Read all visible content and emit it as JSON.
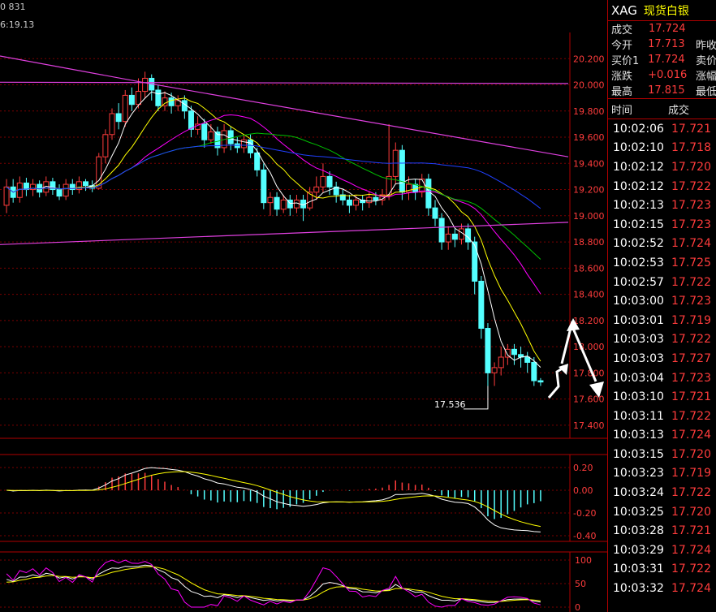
{
  "header": {
    "code_partial": "0 831",
    "time_partial": "6:19.13"
  },
  "axis": {
    "main": [
      "20.200",
      "20.000",
      "19.800",
      "19.600",
      "19.400",
      "19.200",
      "19.000",
      "18.800",
      "18.600",
      "18.400",
      "18.200",
      "18.000",
      "17.800",
      "17.600",
      "17.400"
    ],
    "macd": [
      "0.20",
      "0.00",
      "-0.20",
      "-0.40"
    ],
    "kdj": [
      "100",
      "50",
      "0"
    ]
  },
  "low_annotation": "17.536",
  "colors": {
    "up": "#ff3c3c",
    "down": "#54ffff",
    "grid": "#7a0000",
    "ma5": "#ffffff",
    "ma10": "#ffff00",
    "ma20": "#ff00ff",
    "ma30": "#00c000",
    "ma60": "#2040ff",
    "trend": "#e040e0"
  },
  "quote": {
    "code": "XAG",
    "name": "现货白银",
    "rows": [
      {
        "label": "成交",
        "value": "17.724",
        "label2": ""
      },
      {
        "label": "今开",
        "value": "17.713",
        "label2": "昨收"
      },
      {
        "label": "买价1",
        "value": "17.724",
        "label2": "卖价"
      },
      {
        "label": "涨跌",
        "value": "+0.016",
        "label2": "涨幅"
      },
      {
        "label": "最高",
        "value": "17.815",
        "label2": "最低"
      }
    ]
  },
  "ticks": {
    "header": {
      "time": "时间",
      "price": "成交"
    },
    "rows": [
      {
        "time": "10:02:06",
        "price": "17.721"
      },
      {
        "time": "10:02:10",
        "price": "17.718"
      },
      {
        "time": "10:02:12",
        "price": "17.720"
      },
      {
        "time": "10:02:12",
        "price": "17.722"
      },
      {
        "time": "10:02:13",
        "price": "17.723"
      },
      {
        "time": "10:02:15",
        "price": "17.723"
      },
      {
        "time": "10:02:52",
        "price": "17.724"
      },
      {
        "time": "10:02:53",
        "price": "17.725"
      },
      {
        "time": "10:02:57",
        "price": "17.722"
      },
      {
        "time": "10:03:00",
        "price": "17.723"
      },
      {
        "time": "10:03:01",
        "price": "17.719"
      },
      {
        "time": "10:03:03",
        "price": "17.722"
      },
      {
        "time": "10:03:03",
        "price": "17.727"
      },
      {
        "time": "10:03:04",
        "price": "17.723"
      },
      {
        "time": "10:03:10",
        "price": "17.721"
      },
      {
        "time": "10:03:11",
        "price": "17.722"
      },
      {
        "time": "10:03:13",
        "price": "17.724"
      },
      {
        "time": "10:03:15",
        "price": "17.720"
      },
      {
        "time": "10:03:23",
        "price": "17.719"
      },
      {
        "time": "10:03:24",
        "price": "17.722"
      },
      {
        "time": "10:03:25",
        "price": "17.720"
      },
      {
        "time": "10:03:28",
        "price": "17.721"
      },
      {
        "time": "10:03:29",
        "price": "17.724"
      },
      {
        "time": "10:03:31",
        "price": "17.722"
      },
      {
        "time": "10:03:32",
        "price": "17.724"
      }
    ]
  },
  "chart_data": {
    "type": "candlestick",
    "ylim": [
      17.3,
      20.4
    ],
    "candles": [
      [
        19.08,
        19.22,
        19.02,
        19.28
      ],
      [
        19.22,
        19.14,
        19.1,
        19.28
      ],
      [
        19.14,
        19.25,
        19.1,
        19.3
      ],
      [
        19.25,
        19.2,
        19.15,
        19.29
      ],
      [
        19.2,
        19.24,
        19.15,
        19.28
      ],
      [
        19.24,
        19.18,
        19.14,
        19.27
      ],
      [
        19.18,
        19.26,
        19.15,
        19.3
      ],
      [
        19.26,
        19.2,
        19.16,
        19.29
      ],
      [
        19.2,
        19.15,
        19.12,
        19.24
      ],
      [
        19.15,
        19.24,
        19.12,
        19.28
      ],
      [
        19.24,
        19.2,
        19.16,
        19.28
      ],
      [
        19.2,
        19.26,
        19.17,
        19.3
      ],
      [
        19.26,
        19.23,
        19.19,
        19.28
      ],
      [
        19.23,
        19.21,
        19.18,
        19.27
      ],
      [
        19.21,
        19.45,
        19.2,
        19.48
      ],
      [
        19.45,
        19.62,
        19.4,
        19.66
      ],
      [
        19.62,
        19.78,
        19.58,
        19.82
      ],
      [
        19.78,
        19.72,
        19.66,
        19.86
      ],
      [
        19.72,
        19.92,
        19.68,
        19.96
      ],
      [
        19.92,
        19.85,
        19.8,
        19.98
      ],
      [
        19.85,
        19.95,
        19.82,
        20.05
      ],
      [
        19.95,
        20.05,
        19.9,
        20.1
      ],
      [
        20.05,
        19.96,
        19.88,
        20.08
      ],
      [
        19.96,
        19.84,
        19.8,
        20.0
      ],
      [
        19.84,
        19.9,
        19.8,
        19.95
      ],
      [
        19.9,
        19.84,
        19.78,
        19.94
      ],
      [
        19.84,
        19.88,
        19.8,
        19.92
      ],
      [
        19.88,
        19.8,
        19.74,
        19.92
      ],
      [
        19.8,
        19.66,
        19.6,
        19.84
      ],
      [
        19.66,
        19.7,
        19.62,
        19.76
      ],
      [
        19.7,
        19.58,
        19.52,
        19.74
      ],
      [
        19.58,
        19.64,
        19.55,
        19.7
      ],
      [
        19.64,
        19.52,
        19.46,
        19.68
      ],
      [
        19.52,
        19.65,
        19.48,
        19.7
      ],
      [
        19.65,
        19.55,
        19.5,
        19.68
      ],
      [
        19.55,
        19.52,
        19.48,
        19.6
      ],
      [
        19.52,
        19.58,
        19.48,
        19.62
      ],
      [
        19.58,
        19.48,
        19.44,
        19.62
      ],
      [
        19.48,
        19.35,
        19.3,
        19.52
      ],
      [
        19.35,
        19.1,
        19.05,
        19.4
      ],
      [
        19.1,
        19.14,
        19.0,
        19.18
      ],
      [
        19.14,
        19.05,
        19.0,
        19.18
      ],
      [
        19.05,
        19.12,
        19.02,
        19.16
      ],
      [
        19.12,
        19.06,
        19.0,
        19.16
      ],
      [
        19.06,
        19.12,
        19.02,
        19.16
      ],
      [
        19.12,
        19.06,
        18.96,
        19.16
      ],
      [
        19.06,
        19.18,
        19.04,
        19.22
      ],
      [
        19.18,
        19.22,
        19.12,
        19.3
      ],
      [
        19.22,
        19.3,
        19.18,
        19.4
      ],
      [
        19.3,
        19.22,
        19.16,
        19.34
      ],
      [
        19.22,
        19.16,
        19.1,
        19.26
      ],
      [
        19.16,
        19.12,
        19.08,
        19.2
      ],
      [
        19.12,
        19.08,
        19.02,
        19.16
      ],
      [
        19.08,
        19.12,
        19.04,
        19.16
      ],
      [
        19.12,
        19.1,
        19.04,
        19.16
      ],
      [
        19.1,
        19.14,
        19.06,
        19.18
      ],
      [
        19.14,
        19.12,
        19.08,
        19.18
      ],
      [
        19.12,
        19.16,
        19.08,
        19.2
      ],
      [
        19.16,
        19.3,
        19.12,
        19.7
      ],
      [
        19.3,
        19.5,
        19.24,
        19.56
      ],
      [
        19.5,
        19.18,
        19.12,
        19.54
      ],
      [
        19.18,
        19.24,
        19.12,
        19.3
      ],
      [
        19.24,
        19.18,
        19.12,
        19.28
      ],
      [
        19.18,
        19.28,
        19.14,
        19.32
      ],
      [
        19.28,
        19.06,
        19.0,
        19.32
      ],
      [
        19.06,
        18.98,
        18.92,
        19.12
      ],
      [
        18.98,
        18.8,
        18.74,
        19.02
      ],
      [
        18.8,
        18.86,
        18.74,
        18.92
      ],
      [
        18.86,
        18.82,
        18.76,
        18.9
      ],
      [
        18.82,
        18.9,
        18.78,
        18.94
      ],
      [
        18.9,
        18.8,
        18.74,
        18.94
      ],
      [
        18.8,
        18.5,
        18.4,
        18.84
      ],
      [
        18.5,
        18.14,
        18.06,
        18.54
      ],
      [
        18.14,
        17.8,
        17.7,
        18.18
      ],
      [
        17.8,
        17.84,
        17.7,
        17.88
      ],
      [
        17.84,
        17.92,
        17.78,
        18.0
      ],
      [
        17.92,
        17.98,
        17.86,
        18.02
      ],
      [
        17.98,
        17.94,
        17.86,
        18.02
      ],
      [
        17.94,
        17.92,
        17.84,
        18.0
      ],
      [
        17.92,
        17.88,
        17.8,
        17.96
      ],
      [
        17.88,
        17.74,
        17.7,
        17.92
      ],
      [
        17.74,
        17.73,
        17.7,
        17.76
      ]
    ],
    "trendlines": [
      [
        [
          0,
          20.22
        ],
        [
          175,
          20.02
        ],
        [
          700,
          19.45
        ]
      ],
      [
        [
          0,
          20.02
        ],
        [
          700,
          20.01
        ]
      ],
      [
        [
          0,
          18.78
        ],
        [
          700,
          18.95
        ]
      ]
    ]
  }
}
